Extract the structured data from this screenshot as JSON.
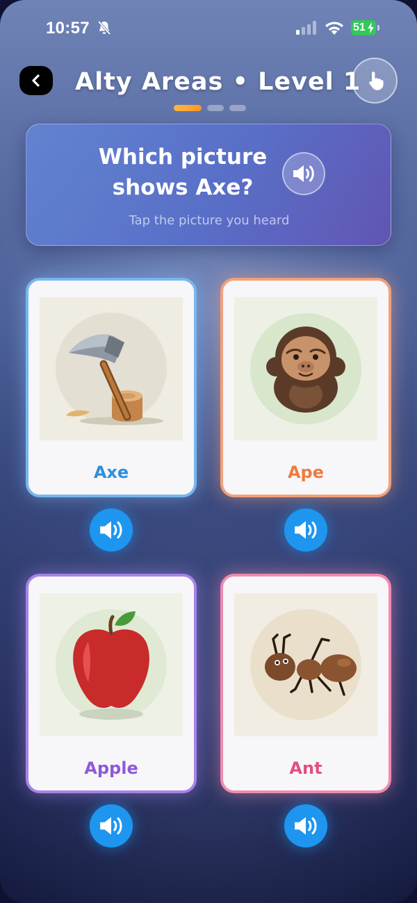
{
  "status_bar": {
    "time": "10:57",
    "battery": "51"
  },
  "header": {
    "title": "Alty Areas • Level 1"
  },
  "progress": {
    "current_step": 1,
    "total_steps": 3
  },
  "question": {
    "text": "Which picture shows Axe?",
    "hint": "Tap the picture you heard"
  },
  "choices": [
    {
      "label": "Axe",
      "color": "#2f8fdc"
    },
    {
      "label": "Ape",
      "color": "#ee7b3f"
    },
    {
      "label": "Apple",
      "color": "#8f58d8"
    },
    {
      "label": "Ant",
      "color": "#e2507f"
    }
  ],
  "colors": {
    "sound_button": "#1e96ef",
    "progress_active": "#ff9f2a",
    "battery": "#34c759"
  }
}
